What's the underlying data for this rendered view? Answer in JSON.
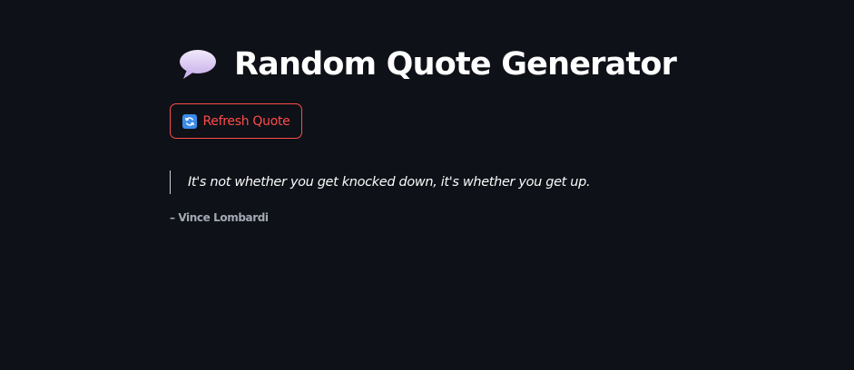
{
  "header": {
    "icon": "speech-balloon-icon",
    "title": "Random Quote Generator"
  },
  "refresh_button": {
    "icon": "refresh-icon",
    "label": "Refresh Quote"
  },
  "quote": {
    "text": "It's not whether you get knocked down, it's whether you get up.",
    "author": "– Vince Lombardi"
  },
  "colors": {
    "background": "#0e1117",
    "accent": "#ff4b4b",
    "text": "#fafafa",
    "muted": "#a3a8b4",
    "refresh_icon_bg": "#3b8beb",
    "speech_bubble": "#d9c8f2"
  }
}
